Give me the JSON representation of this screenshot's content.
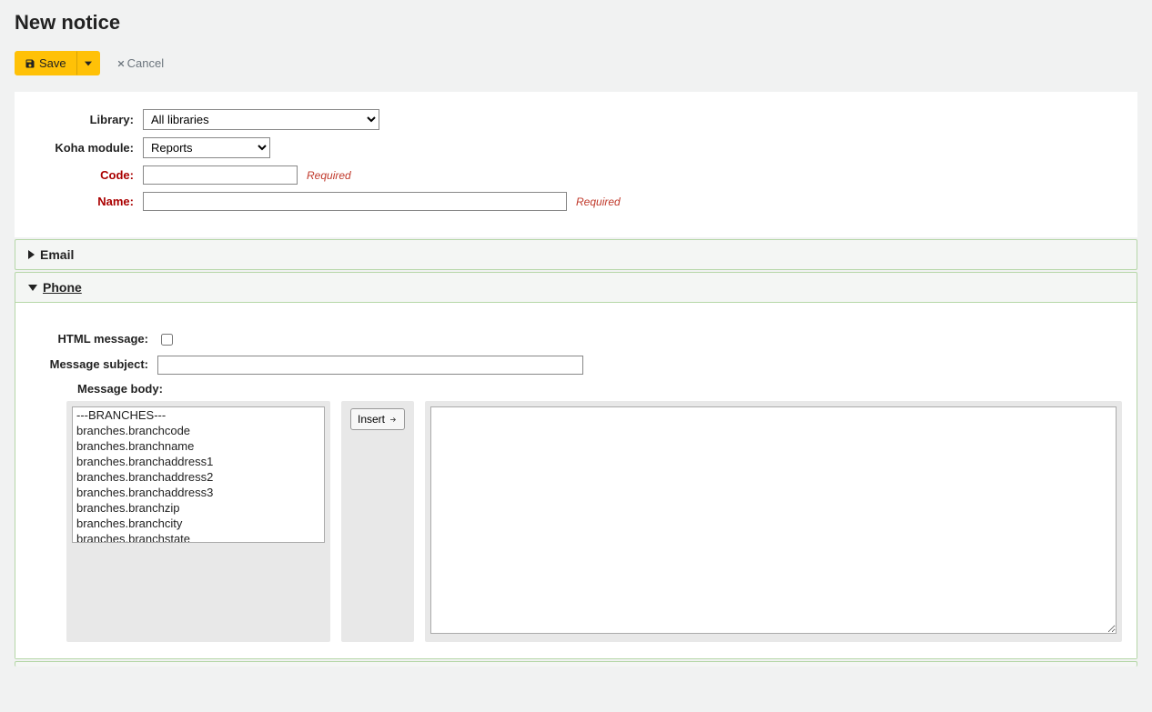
{
  "page": {
    "title": "New notice"
  },
  "toolbar": {
    "save_label": "Save",
    "cancel_label": "Cancel"
  },
  "form": {
    "library_label": "Library:",
    "library_value": "All libraries",
    "module_label": "Koha module:",
    "module_value": "Reports",
    "code_label": "Code:",
    "code_value": "",
    "name_label": "Name:",
    "name_value": "",
    "required_text": "Required"
  },
  "sections": {
    "email": {
      "title": "Email",
      "expanded": false
    },
    "phone": {
      "title": "Phone",
      "expanded": true,
      "html_message_label": "HTML message:",
      "html_message_checked": false,
      "subject_label": "Message subject:",
      "subject_value": "",
      "body_label": "Message body:",
      "insert_label": "Insert",
      "body_value": "",
      "fields": [
        "---BRANCHES---",
        "branches.branchcode",
        "branches.branchname",
        "branches.branchaddress1",
        "branches.branchaddress2",
        "branches.branchaddress3",
        "branches.branchzip",
        "branches.branchcity",
        "branches.branchstate"
      ]
    }
  }
}
